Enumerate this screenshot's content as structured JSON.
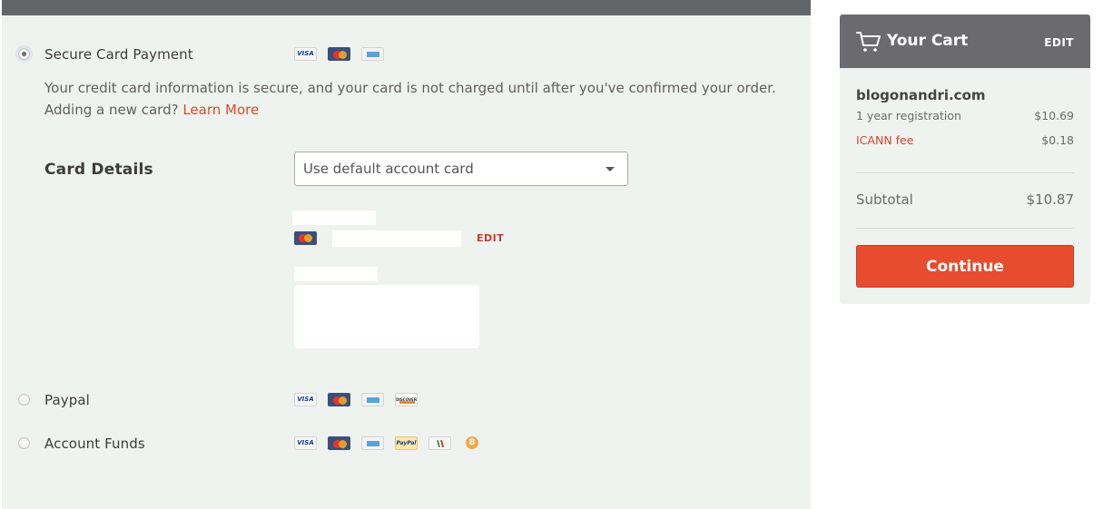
{
  "payment": {
    "options": [
      {
        "label": "Secure Card Payment",
        "selected": true,
        "methods": [
          "visa-icon",
          "mastercard-icon",
          "amex-icon"
        ]
      },
      {
        "label": "Paypal",
        "selected": false,
        "methods": [
          "visa-icon",
          "mastercard-icon",
          "amex-icon",
          "discover-icon"
        ]
      },
      {
        "label": "Account Funds",
        "selected": false,
        "methods": [
          "visa-icon",
          "mastercard-icon",
          "amex-icon",
          "paypal-icon",
          "wallet-icon",
          "bitcoin-icon"
        ]
      }
    ],
    "visa_text": "VISA",
    "discover_text": "DISCOVER",
    "paypal_text": "PayPal",
    "bitcoin_text": "B",
    "description": "Your credit card information is secure, and your card is not charged until after you've confirmed your order.",
    "adding_prompt": "Adding a new card?",
    "learn_more": "Learn More",
    "card_details_label": "Card Details",
    "card_select": {
      "value": "Use default account card"
    },
    "card_edit": "EDIT"
  },
  "cart": {
    "title": "Your Cart",
    "edit": "EDIT",
    "domain": "blogonandri.com",
    "items": [
      {
        "label": "1 year registration",
        "price": "$10.69"
      },
      {
        "label": "ICANN fee",
        "price": "$0.18"
      }
    ],
    "subtotal_label": "Subtotal",
    "subtotal_value": "$10.87",
    "continue_label": "Continue"
  },
  "colors": {
    "accent": "#e84c2f",
    "link": "#dd4b29",
    "header": "#6b6b6e",
    "panel": "#eff3ef"
  }
}
